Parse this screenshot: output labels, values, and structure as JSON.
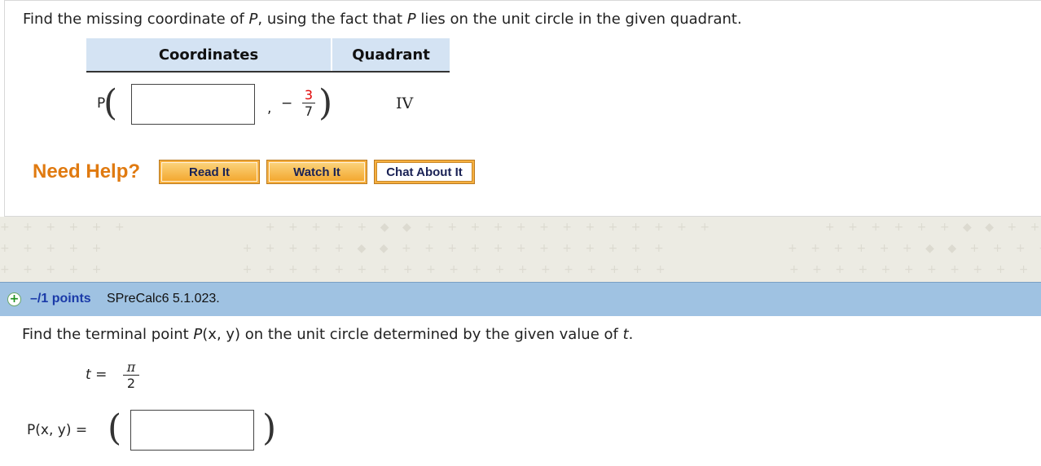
{
  "q1": {
    "text_before_p1": "Find the missing coordinate of ",
    "p1": "P",
    "text_middle": ", using the fact that ",
    "p2": "P",
    "text_after": " lies on the unit circle in the given quadrant.",
    "table": {
      "headers": [
        "Coordinates",
        "Quadrant"
      ],
      "point_label": "P",
      "x_value": "",
      "comma": ",",
      "y_sign": "−",
      "y_numerator": "3",
      "y_denominator": "7",
      "quadrant": "IV"
    },
    "help": {
      "label": "Need Help?",
      "buttons": [
        "Read It",
        "Watch It",
        "Chat About It"
      ]
    }
  },
  "q2": {
    "points": "–/1 points",
    "id": "SPreCalc6 5.1.023.",
    "text_before_p": "Find the terminal point ",
    "p": "P",
    "text_xy": "(x, y)",
    "text_middle": " on the unit circle determined by the given value of ",
    "t": "t",
    "period": ".",
    "t_label": "t",
    "equals": " = ",
    "t_numerator": "π",
    "t_denominator": "2",
    "pxy_label": "P(x, y)",
    "pxy_equals": " =",
    "answer_value": ""
  },
  "colors": {
    "help": "#e07a10",
    "header_blue": "#9fc2e2",
    "table_header": "#d4e3f3",
    "fraction_red": "#e00000",
    "points_blue": "#1a3aa8"
  },
  "icons": {
    "expand": "plus-icon"
  }
}
